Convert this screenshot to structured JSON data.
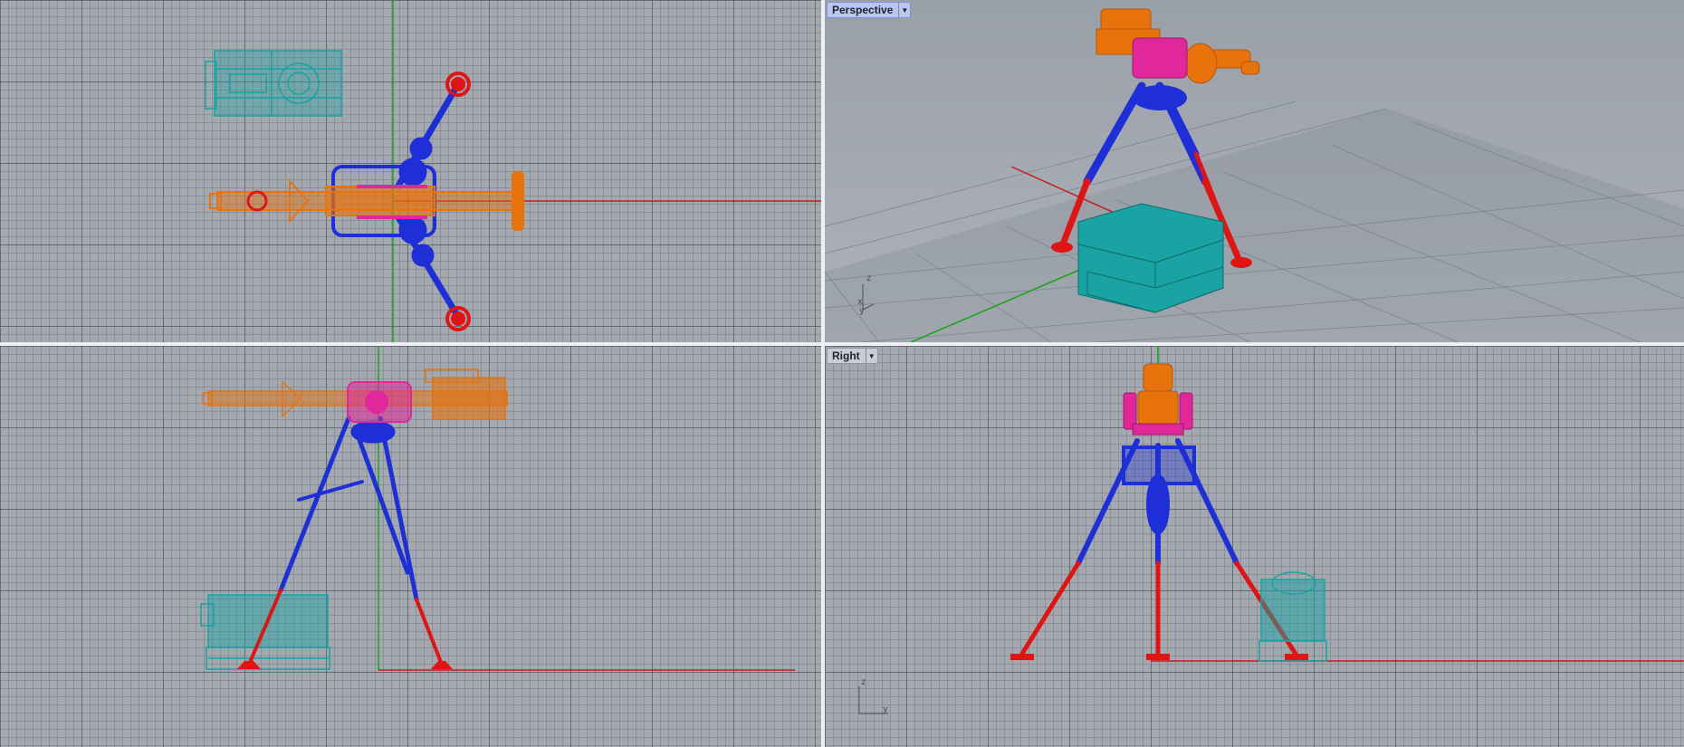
{
  "viewports": {
    "top": {
      "label": ""
    },
    "perspective": {
      "label": "Perspective"
    },
    "front": {
      "label": ""
    },
    "right": {
      "label": "Right"
    }
  },
  "axes": {
    "x": "x",
    "y": "y",
    "z": "z"
  },
  "colors": {
    "background": "#a4a9b0",
    "grid": "#6b727c",
    "x_axis": "#c41d1d",
    "y_axis": "#19a319",
    "barrel": "#e8720c",
    "mount": "#e0289b",
    "tripod": "#1e2fd8",
    "feet": "#e01414",
    "crate": "#19a3a3"
  },
  "icons": {
    "viewport_menu": "chevron-down-icon"
  }
}
